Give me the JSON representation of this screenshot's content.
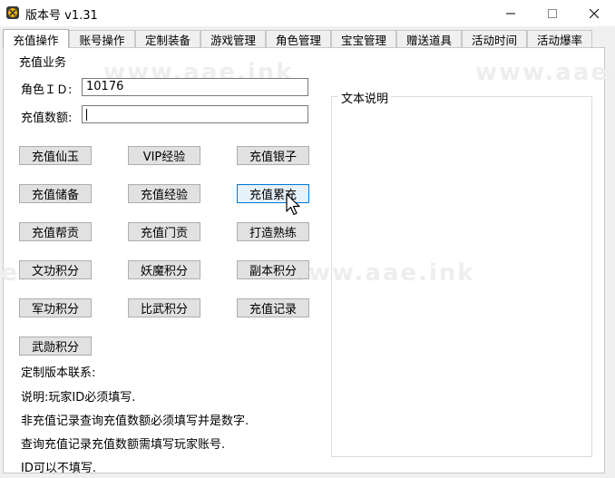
{
  "window": {
    "title": "版本号 v1.31"
  },
  "tabs": [
    "充值操作",
    "账号操作",
    "定制装备",
    "游戏管理",
    "角色管理",
    "宝宝管理",
    "赠送道具",
    "活动时间",
    "活动爆率"
  ],
  "watermark": "www.aae.ink",
  "recharge": {
    "group_title": "充值业务",
    "role_id_label": "角色ＩＤ:",
    "role_id_value": "10176",
    "amount_label": "充值数额:",
    "amount_value": "",
    "buttons": [
      "充值仙玉",
      "VIP经验",
      "充值银子",
      "充值储备",
      "充值经验",
      "充值累充",
      "充值帮贡",
      "充值门贡",
      "打造熟练",
      "文功积分",
      "妖魔积分",
      "副本积分",
      "军功积分",
      "比武积分",
      "充值记录",
      "武勋积分"
    ],
    "notes": [
      "定制版本联系:",
      "说明:玩家ID必须填写.",
      "非充值记录查询充值数额必须填写并是数字.",
      "查询充值记录充值数额需填写玩家账号.",
      "ID可以不填写."
    ]
  },
  "text_panel": {
    "title": "文本说明",
    "content": ""
  }
}
